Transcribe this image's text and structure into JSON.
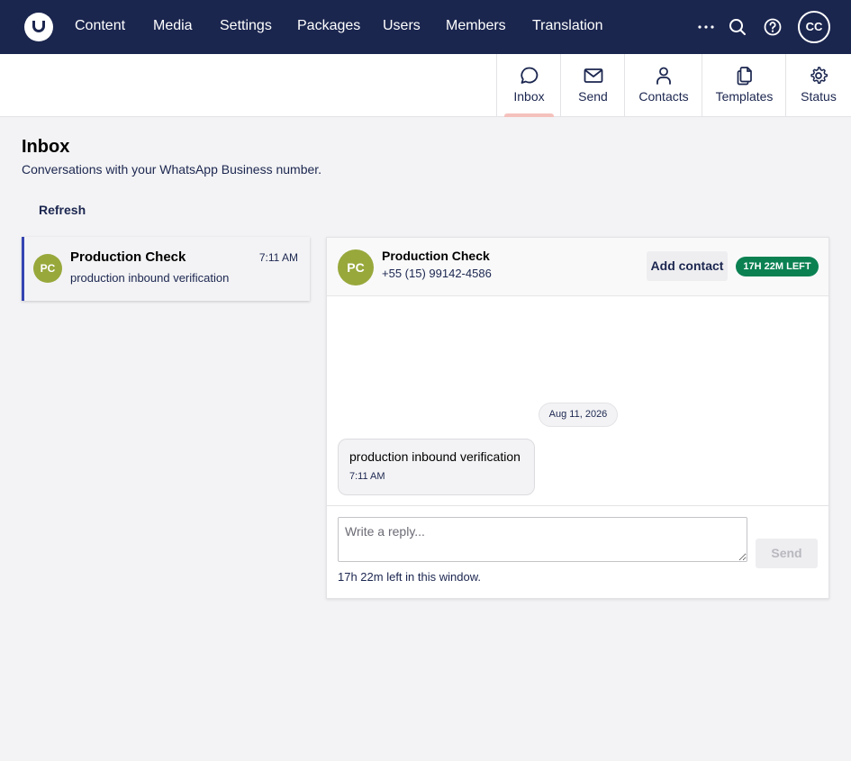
{
  "topnav": {
    "items": [
      "Content",
      "Media",
      "Settings",
      "Packages",
      "Users",
      "Members",
      "Translation"
    ],
    "avatar": "CC",
    "icons": [
      "more-icon",
      "search-icon",
      "help-icon"
    ]
  },
  "tabs": [
    {
      "label": "Inbox",
      "icon": "chat-bubble-icon",
      "active": true
    },
    {
      "label": "Send",
      "icon": "envelope-icon"
    },
    {
      "label": "Contacts",
      "icon": "person-icon"
    },
    {
      "label": "Templates",
      "icon": "documents-icon"
    },
    {
      "label": "Status",
      "icon": "gear-icon"
    }
  ],
  "page": {
    "title": "Inbox",
    "subtitle": "Conversations with your WhatsApp Business number.",
    "refresh_label": "Refresh"
  },
  "conversations": [
    {
      "initials": "PC",
      "name": "Production Check",
      "time": "7:11 AM",
      "preview": "production inbound verification"
    }
  ],
  "chat": {
    "initials": "PC",
    "name": "Production Check",
    "phone": "+55 (15) 99142-4586",
    "add_contact_label": "Add contact",
    "window_badge": "17H 22M LEFT",
    "date_separator": "Aug 11, 2026",
    "messages": [
      {
        "text": "production inbound verification",
        "time": "7:11 AM"
      }
    ],
    "reply_placeholder": "Write a reply...",
    "send_label": "Send",
    "window_note": "17h 22m left in this window."
  },
  "colors": {
    "navy": "#1b264f",
    "avatar_olive": "#98a83b",
    "badge_green": "#0b8152",
    "active_border": "#3544b1",
    "tab_active_indicator": "#f5c1bc"
  }
}
